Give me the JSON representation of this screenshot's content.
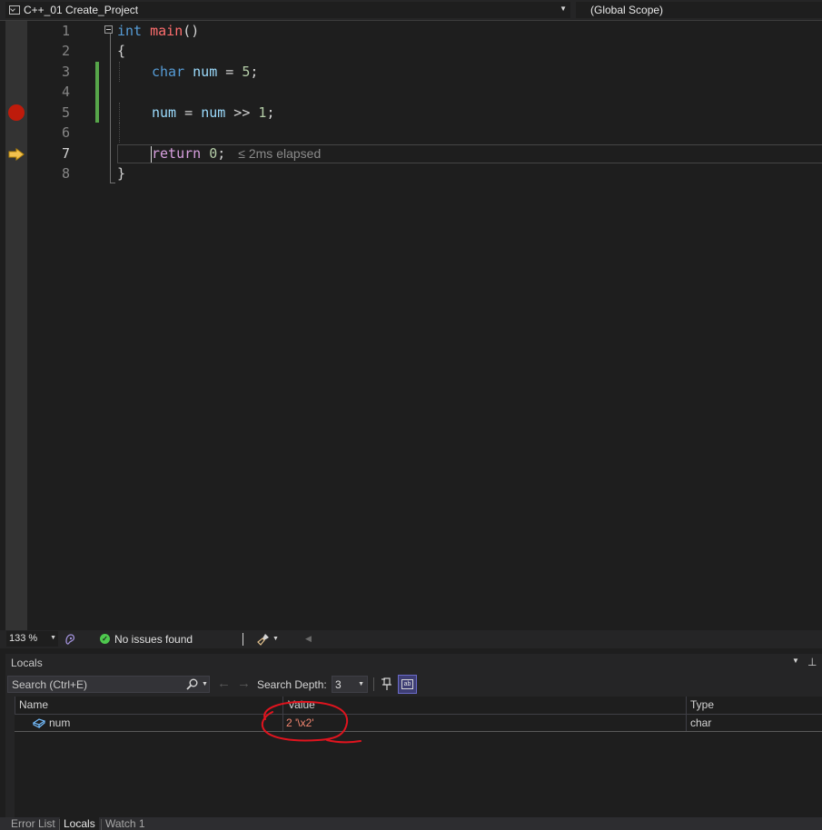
{
  "navbar": {
    "project": "C++_01 Create_Project",
    "scope": "(Global Scope)"
  },
  "editor": {
    "line_numbers": [
      "1",
      "2",
      "3",
      "4",
      "5",
      "6",
      "7",
      "8"
    ],
    "lines": {
      "l1": {
        "kw": "int",
        "fn": "main",
        "punc": "()"
      },
      "l2": {
        "punc": "{"
      },
      "l3": {
        "kw": "char",
        "id": "num",
        "op": " = ",
        "num": "5",
        "end": ";"
      },
      "l5": {
        "id1": "num",
        "op1": " = ",
        "id2": "num",
        "op2": " >> ",
        "num": "1",
        "end": ";"
      },
      "l7": {
        "kw": "return",
        "num": "0",
        "end": ";",
        "hint": "≤ 2ms elapsed"
      },
      "l8": {
        "punc": "}"
      }
    },
    "breakpoint_line": 5,
    "current_line": 7
  },
  "statusbar": {
    "zoom": "133 %",
    "issues": "No issues found"
  },
  "locals": {
    "title": "Locals",
    "search_placeholder": "Search (Ctrl+E)",
    "search_depth_label": "Search Depth:",
    "search_depth_value": "3",
    "columns": {
      "name": "Name",
      "value": "Value",
      "type": "Type"
    },
    "rows": [
      {
        "name": "num",
        "value": "2 '\\x2'",
        "type": "char"
      }
    ]
  },
  "tabs": [
    "Error List",
    "Locals",
    "Watch 1"
  ],
  "colors": {
    "keyword": "#569cd6",
    "control_keyword": "#d8a0df",
    "function": "#ff6e6e",
    "identifier": "#9cdcfe",
    "number": "#b5cea8",
    "breakpoint": "#e51400",
    "changed_value": "#f48771",
    "annotation": "#e0141e"
  },
  "icons": {
    "project": "cpp-project-icon",
    "breakpoint": "breakpoint-icon",
    "execution": "execution-pointer-arrow-icon",
    "issues": "check-circle-icon",
    "variable": "local-variable-icon"
  }
}
